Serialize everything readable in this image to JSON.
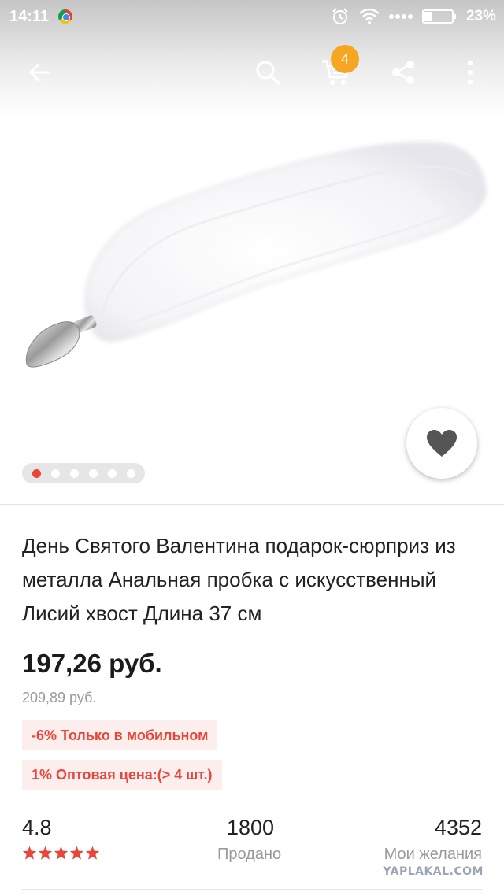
{
  "status_bar": {
    "time": "14:11",
    "battery_percent": "23%",
    "icons": [
      "chrome-icon",
      "alarm-icon",
      "wifi-icon",
      "signal-dots-icon",
      "battery-icon"
    ]
  },
  "toolbar": {
    "icons": [
      "back-arrow-icon",
      "search-icon",
      "cart-icon",
      "share-icon",
      "more-vertical-icon"
    ],
    "cart_count": "4"
  },
  "gallery": {
    "image_count": 6,
    "active_index": 0,
    "image_subject": "fur-tail-product-photo-icon"
  },
  "product": {
    "title": "День Святого Валентина подарок-сюрприз из металла Анальная пробка с искусственный Лисий хвост Длина 37 см",
    "price": "197,26 руб.",
    "old_price": "209,89 руб.",
    "promos": [
      "-6% Только в мобильном",
      "1% Оптовая цена:(> 4 шт.)"
    ]
  },
  "stats": {
    "rating": "4.8",
    "rating_stars": 5,
    "sold_count": "1800",
    "sold_label": "Продано",
    "wishlist_count": "4352",
    "wishlist_label": "Мои желания"
  },
  "watermark": "YAPLAKAL.COM",
  "colors": {
    "accent": "#e8463a",
    "badge": "#f5a623",
    "promo_bg": "#fdeeee",
    "muted_text": "#9a9a9a"
  }
}
